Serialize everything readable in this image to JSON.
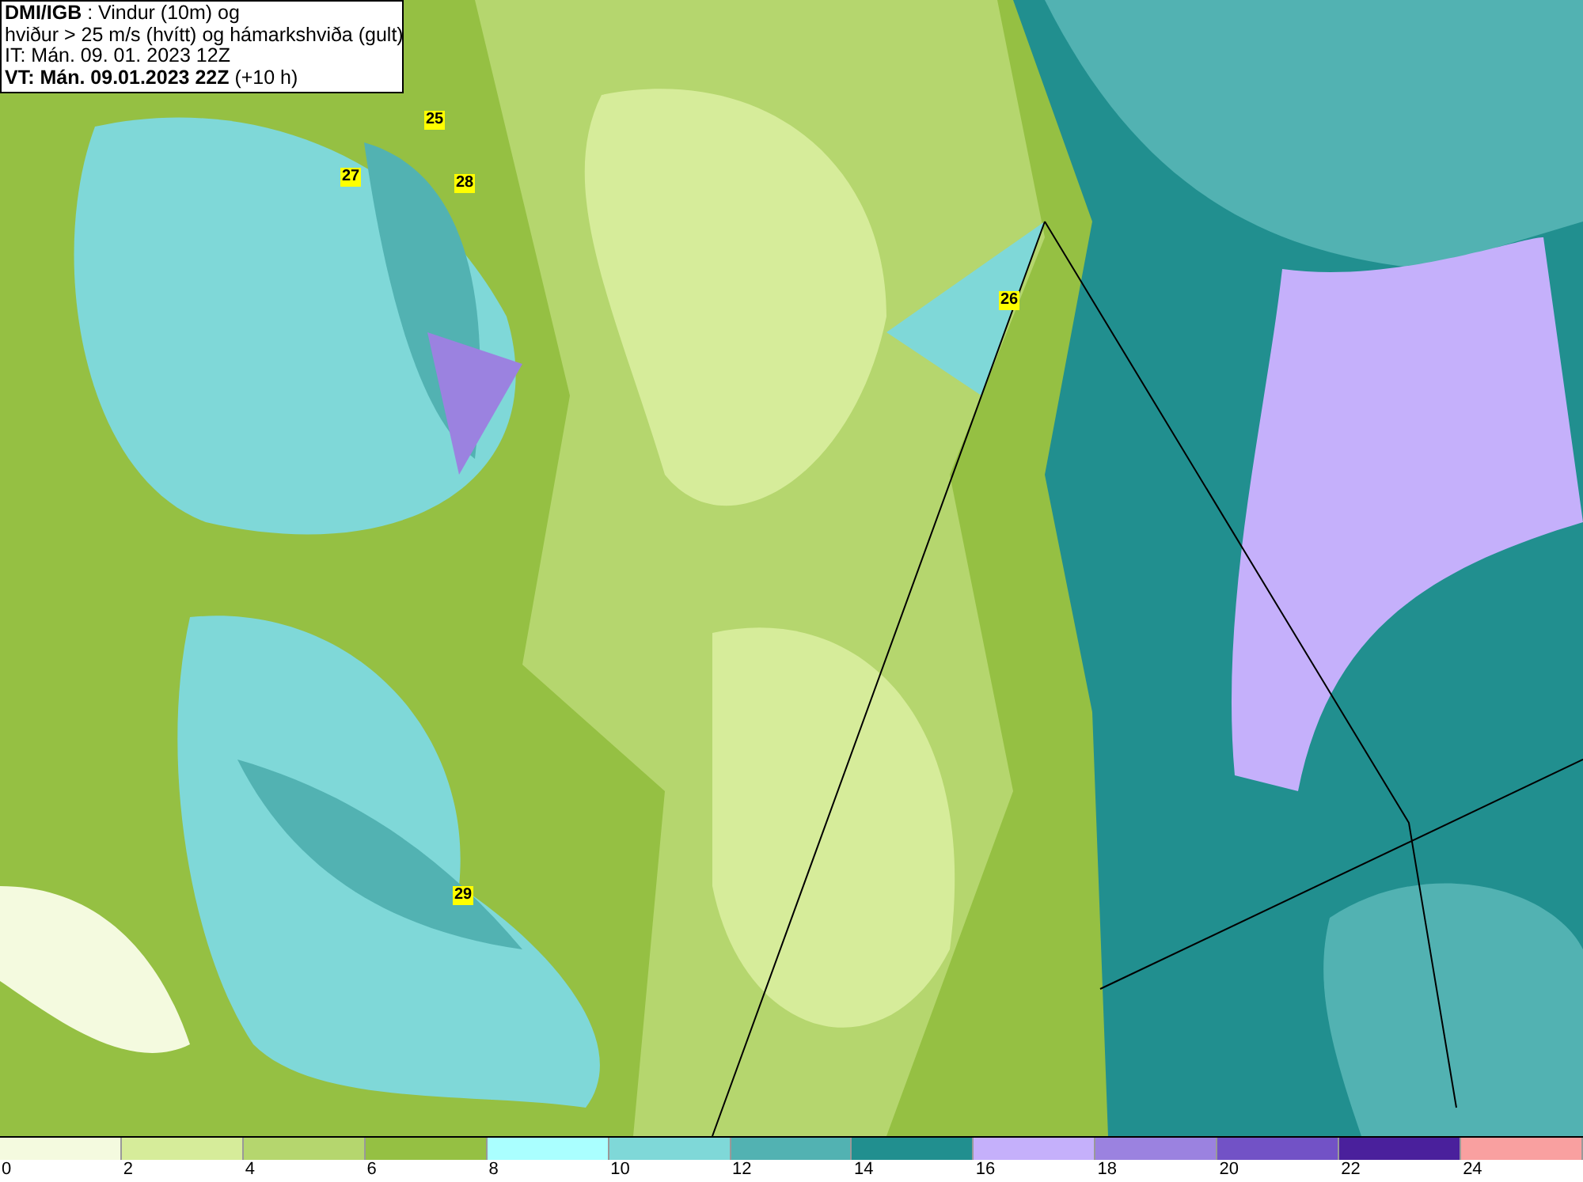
{
  "header": {
    "lines": [
      "**DMI/IGB** : Vindur (10m) og",
      "hviður > 25 m/s (hvítt) og hámarkshviða (gult)",
      "IT: Mán. 09. 01. 2023 12Z",
      "**VT: Mán. 09.01.2023 22Z** (+10 h)"
    ]
  },
  "map": {
    "gust_labels": [
      "25",
      "27",
      "28",
      "26",
      "29"
    ]
  },
  "legend": [
    {
      "label": "0",
      "color": "#f4fadf"
    },
    {
      "label": "2",
      "color": "#d6ec9a"
    },
    {
      "label": "4",
      "color": "#b5d66e"
    },
    {
      "label": "6",
      "color": "#95c043"
    },
    {
      "label": "8",
      "color": "#aaffff"
    },
    {
      "label": "10",
      "color": "#7fd8d8"
    },
    {
      "label": "12",
      "color": "#52b2b2"
    },
    {
      "label": "14",
      "color": "#218f8f"
    },
    {
      "label": "16",
      "color": "#c5b0fb"
    },
    {
      "label": "18",
      "color": "#9b82e0"
    },
    {
      "label": "20",
      "color": "#7252c6"
    },
    {
      "label": "22",
      "color": "#4a209c"
    },
    {
      "label": "24",
      "color": "#f9a0a0"
    }
  ]
}
